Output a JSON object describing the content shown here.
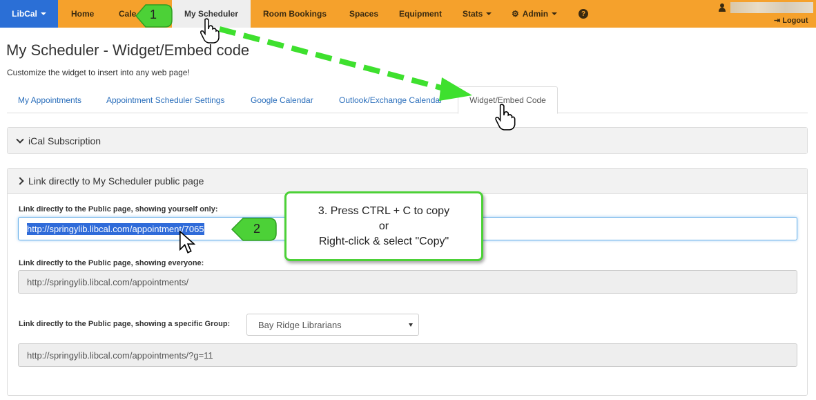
{
  "nav": {
    "brand": "LibCal",
    "items": [
      {
        "label": "Home"
      },
      {
        "label": "Cale"
      },
      {
        "label": "My Scheduler"
      },
      {
        "label": "Room Bookings"
      },
      {
        "label": "Spaces"
      },
      {
        "label": "Equipment"
      },
      {
        "label": "Stats"
      },
      {
        "label": "Admin"
      }
    ],
    "logout": "Logout"
  },
  "page": {
    "title": "My Scheduler - Widget/Embed code",
    "subtitle": "Customize the widget to insert into any web page!"
  },
  "tabs": [
    {
      "label": "My Appointments"
    },
    {
      "label": "Appointment Scheduler Settings"
    },
    {
      "label": "Google Calendar"
    },
    {
      "label": "Outlook/Exchange Calendar"
    },
    {
      "label": "Widget/Embed Code"
    }
  ],
  "panels": {
    "ical": {
      "heading": "iCal Subscription"
    },
    "links": {
      "heading": "Link directly to My Scheduler public page",
      "yourself_label": "Link directly to the Public page, showing yourself only:",
      "yourself_url": "http://springylib.libcal.com/appointment/7065",
      "everyone_label": "Link directly to the Public page, showing everyone:",
      "everyone_url": "http://springylib.libcal.com/appointments/",
      "group_label": "Link directly to the Public page, showing a specific Group:",
      "group_selected": "Bay Ridge Librarians",
      "group_url": "http://springylib.libcal.com/appointments/?g=11"
    }
  },
  "annotations": {
    "step1": "1",
    "step2": "2",
    "callout_line1": "3. Press CTRL + C to copy",
    "callout_line2": "or",
    "callout_line3": "Right-click & select \"Copy\""
  },
  "colors": {
    "nav_bg": "#f5a12c",
    "brand_bg": "#2b6fd6",
    "annotation_green": "#4cd137",
    "link_blue": "#2a6ebb"
  }
}
